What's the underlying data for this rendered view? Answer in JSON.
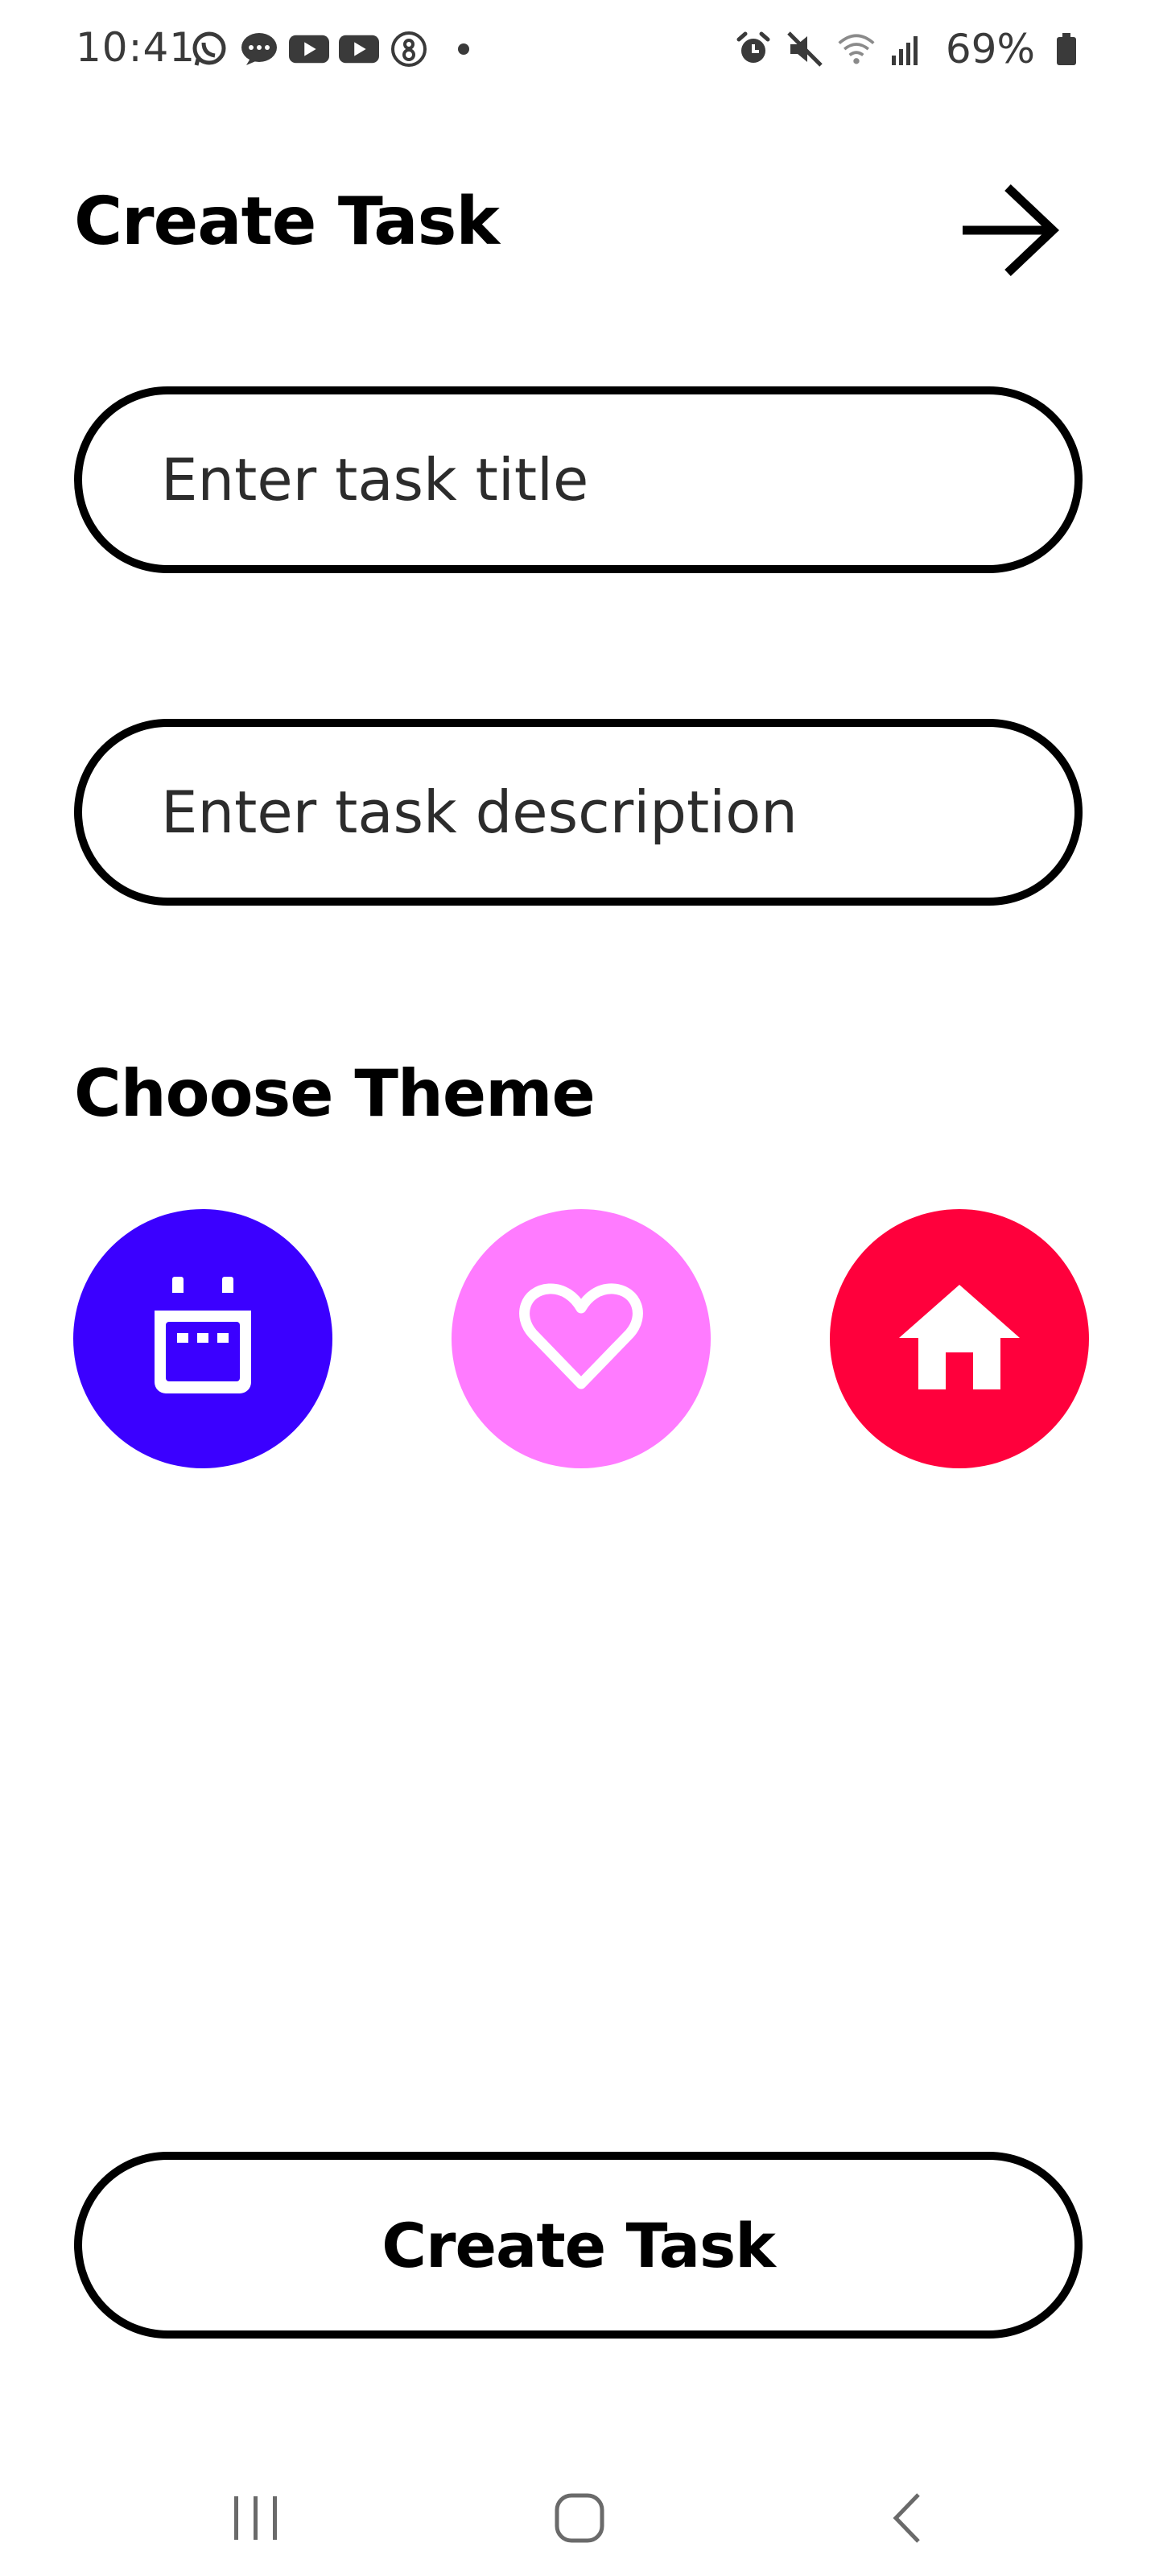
{
  "status_bar": {
    "time": "10:41",
    "notification_icons": [
      "whatsapp-icon",
      "messages-icon",
      "youtube-icon",
      "youtube-icon",
      "app-icon"
    ],
    "system_icons": [
      "alarm-icon",
      "mute-icon",
      "wifi-icon",
      "signal-icon"
    ],
    "battery_percent": "69%"
  },
  "header": {
    "title": "Create Task",
    "next_icon": "arrow-right-icon"
  },
  "form": {
    "title_field": {
      "value": "",
      "placeholder": "Enter task title"
    },
    "description_field": {
      "value": "",
      "placeholder": "Enter task description"
    }
  },
  "themes": {
    "label": "Choose Theme",
    "options": [
      {
        "icon": "calendar-icon",
        "color": "#3B00FF"
      },
      {
        "icon": "heart-icon",
        "color": "#FF7BFF"
      },
      {
        "icon": "home-icon",
        "color": "#FF003C"
      }
    ]
  },
  "actions": {
    "create_label": "Create Task"
  },
  "nav_bar": {
    "buttons": [
      "recents-icon",
      "home-icon",
      "back-icon"
    ]
  }
}
